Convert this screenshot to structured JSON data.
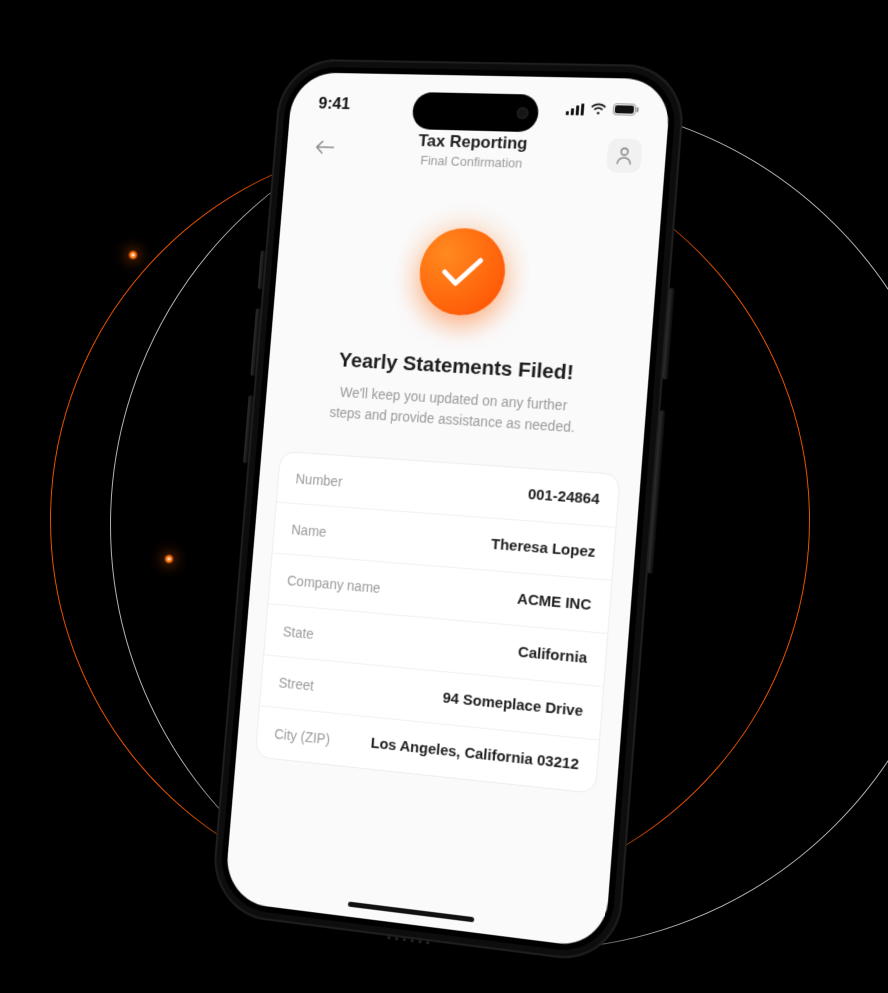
{
  "status": {
    "time": "9:41"
  },
  "header": {
    "title": "Tax Reporting",
    "subtitle": "Final Confirmation"
  },
  "success": {
    "title": "Yearly Statements Filed!",
    "description": "We'll keep you updated on any further steps and provide assistance as needed."
  },
  "details": {
    "rows": [
      {
        "label": "Number",
        "value": "001-24864"
      },
      {
        "label": "Name",
        "value": "Theresa Lopez"
      },
      {
        "label": "Company name",
        "value": "ACME INC"
      },
      {
        "label": "State",
        "value": "California"
      },
      {
        "label": "Street",
        "value": "94 Someplace Drive"
      },
      {
        "label": "City (ZIP)",
        "value": "Los Angeles, California 03212"
      }
    ]
  },
  "colors": {
    "accent": "#ff5a00"
  },
  "icons": {
    "back": "back-arrow-icon",
    "profile": "user-icon",
    "check": "checkmark-icon",
    "signal": "cell-signal-icon",
    "wifi": "wifi-icon",
    "battery": "battery-icon"
  }
}
